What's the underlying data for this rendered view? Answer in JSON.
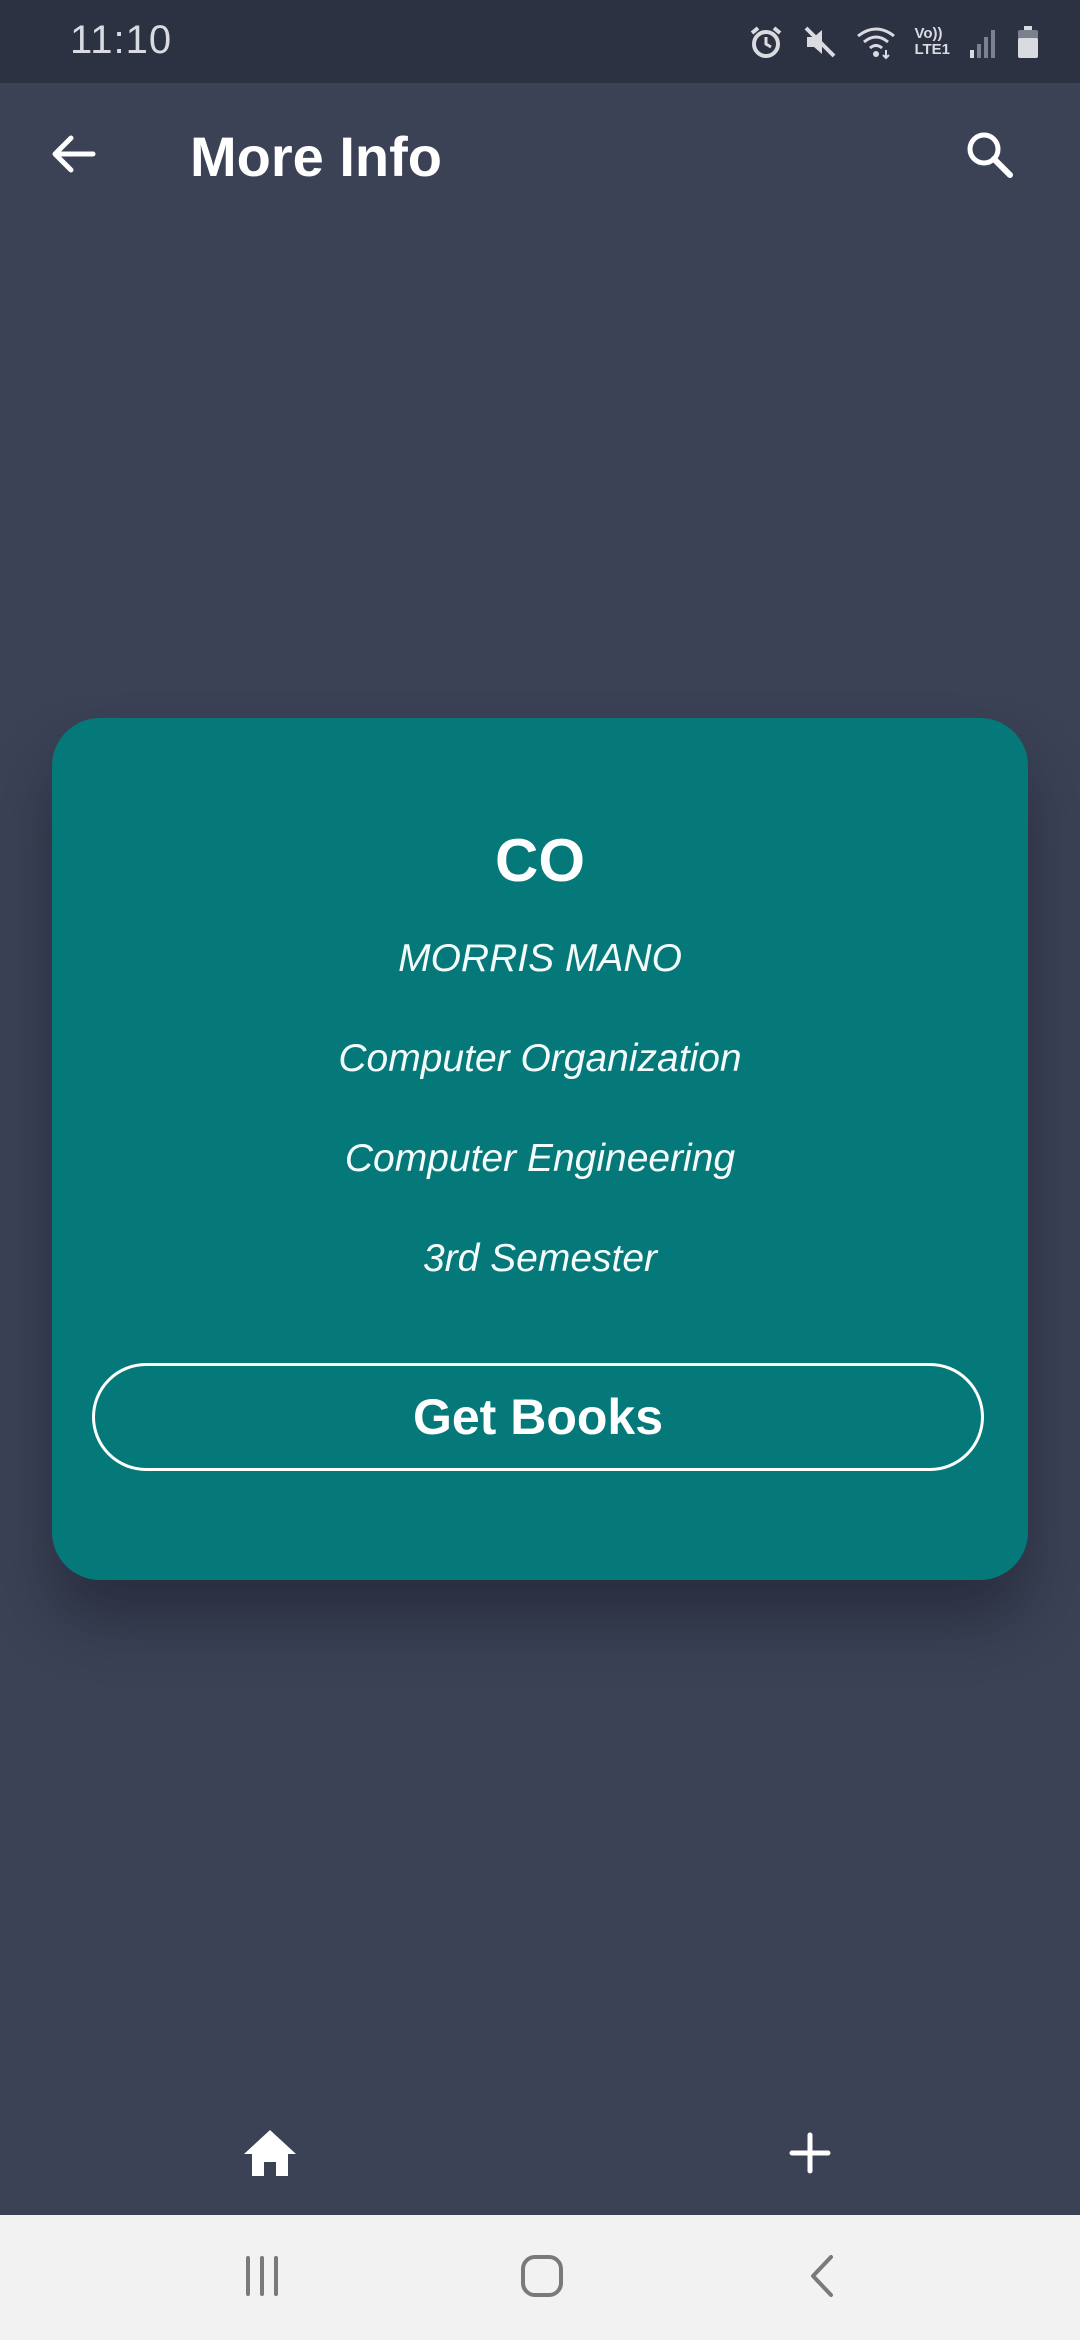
{
  "status_bar": {
    "time": "11:10",
    "volte_label": "Vo))",
    "lte_label": "LTE1",
    "icons": [
      "alarm-icon",
      "mute-icon",
      "wifi-icon",
      "signal-icon",
      "battery-icon"
    ]
  },
  "app_bar": {
    "title": "More Info",
    "back_icon": "arrow-left-icon",
    "search_icon": "search-icon"
  },
  "card": {
    "title": "CO",
    "author": "MORRIS MANO",
    "subject": "Computer Organization",
    "department": "Computer Engineering",
    "semester": "3rd Semester",
    "button_label": "Get Books",
    "background_color": "#05797a"
  },
  "bottom_bar": {
    "icons": [
      "home-icon",
      "plus-icon"
    ]
  },
  "system_nav": {
    "icons": [
      "recents-icon",
      "home-circle-icon",
      "back-chevron-icon"
    ]
  },
  "colors": {
    "background": "#3b4256",
    "status_bar": "#2d3243",
    "card": "#05797a",
    "nav_bar": "#f2f2f2"
  }
}
